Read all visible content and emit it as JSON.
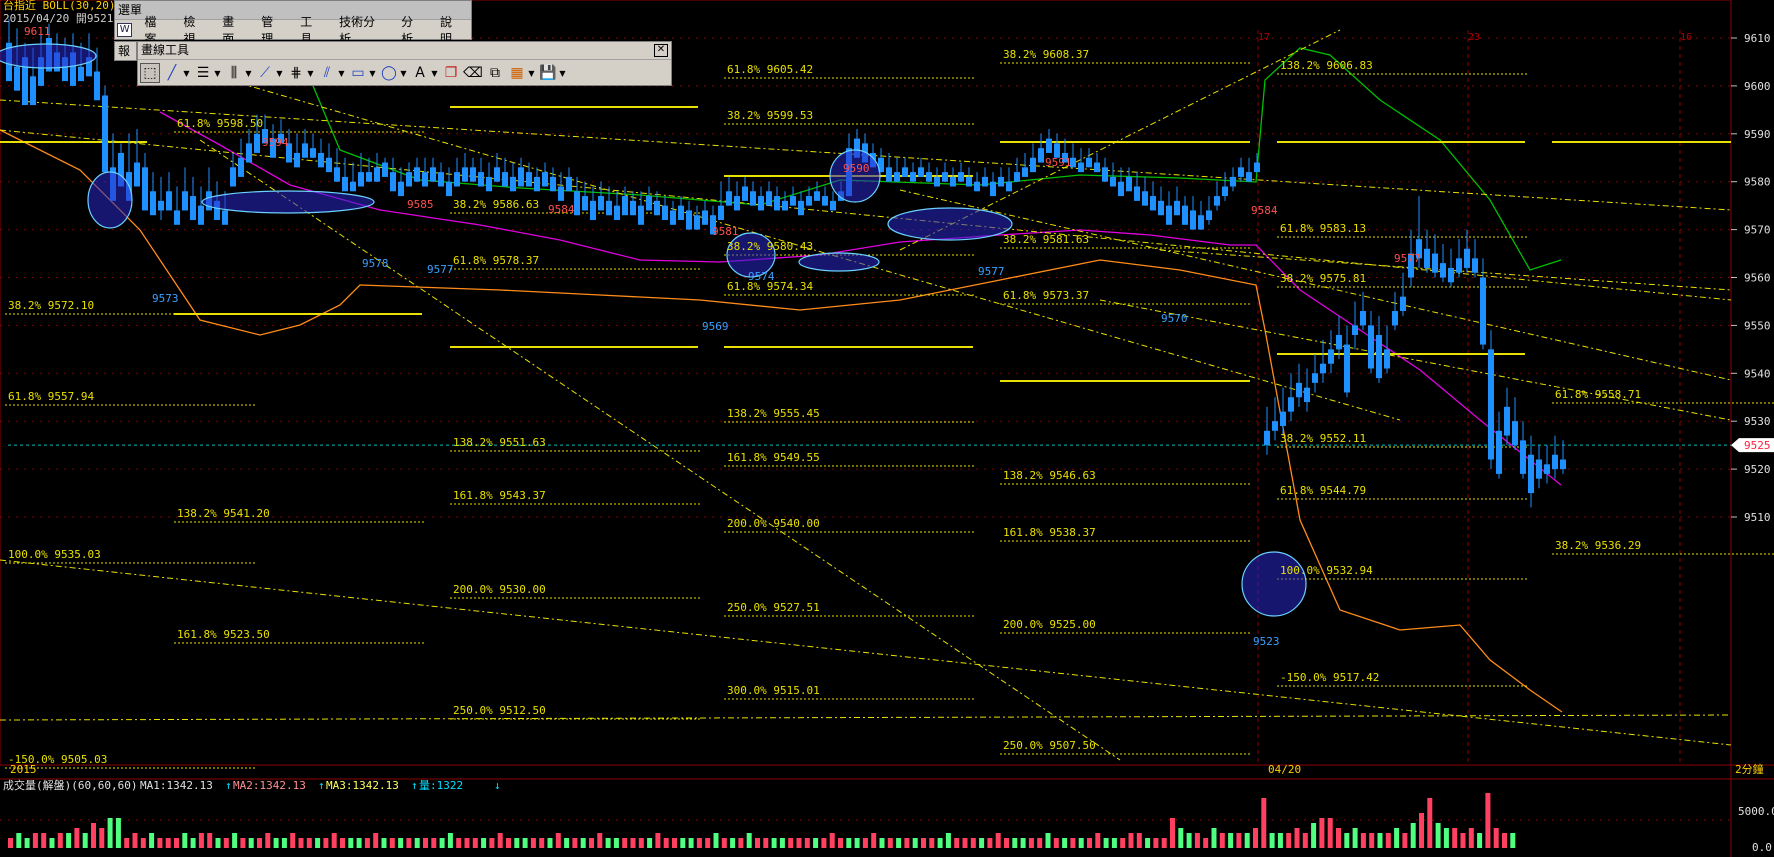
{
  "header": {
    "title": "台指近 BOLL(30,20)",
    "date_open": "2015/04/20 開9521"
  },
  "menu_window": {
    "title": "選單",
    "items": [
      "檔案",
      "檢視",
      "畫面",
      "管理",
      "工具",
      "技術分析",
      "分析",
      "說明"
    ],
    "hidden_tab": "報"
  },
  "drawing_toolbox": {
    "title": "畫線工具",
    "tools": [
      "select-tool-icon",
      "line-tool-icon",
      "hline-tool-icon",
      "vline-tool-icon",
      "fan-tool-icon",
      "fib-tool-icon",
      "channel-tool-icon",
      "rect-tool-icon",
      "ellipse-tool-icon",
      "text-tool-icon",
      "copy-tool-icon",
      "eraser-tool-icon",
      "clone-tool-icon",
      "palette-tool-icon",
      "save-tool-icon"
    ],
    "text_tool_glyph": "A"
  },
  "price_axis": {
    "ticks": [
      "9610",
      "9600",
      "9590",
      "9580",
      "9570",
      "9560",
      "9550",
      "9540",
      "9530",
      "9520",
      "9510"
    ],
    "last_price": "9525"
  },
  "time_axis": {
    "left_label": "2015",
    "mid_label": "04/20",
    "right_label": "2分鐘",
    "session_markers": [
      "17",
      "23",
      "16"
    ]
  },
  "fib_labels": [
    {
      "t": "61.8% 9605.42"
    },
    {
      "t": "38.2% 9599.53"
    },
    {
      "t": "38.2% 9608.37"
    },
    {
      "t": "138.2% 9606.83"
    },
    {
      "t": "61.8% 9598.50"
    },
    {
      "t": "38.2% 9586.63"
    },
    {
      "t": "61.8% 9578.37"
    },
    {
      "t": "38.2% 9580.43"
    },
    {
      "t": "61.8% 9574.34"
    },
    {
      "t": "38.2% 9581.63"
    },
    {
      "t": "61.8% 9573.37"
    },
    {
      "t": "61.8% 9583.13"
    },
    {
      "t": "38.2% 9575.81"
    },
    {
      "t": "38.2% 9572.10"
    },
    {
      "t": "61.8% 9557.94"
    },
    {
      "t": "138.2% 9555.45"
    },
    {
      "t": "61.8% 9558.71"
    },
    {
      "t": "138.2% 9551.63"
    },
    {
      "t": "161.8% 9549.55"
    },
    {
      "t": "38.2% 9552.11"
    },
    {
      "t": "138.2% 9546.63"
    },
    {
      "t": "61.8% 9544.79"
    },
    {
      "t": "161.8% 9543.37"
    },
    {
      "t": "138.2% 9541.20"
    },
    {
      "t": "200.0% 9540.00"
    },
    {
      "t": "161.8% 9538.37"
    },
    {
      "t": "38.2% 9536.29"
    },
    {
      "t": "100.0% 9535.03"
    },
    {
      "t": "100.0% 9532.94"
    },
    {
      "t": "200.0% 9530.00"
    },
    {
      "t": "250.0% 9527.51"
    },
    {
      "t": "200.0% 9525.00"
    },
    {
      "t": "161.8% 9523.50"
    },
    {
      "t": "-150.0% 9517.42"
    },
    {
      "t": "300.0% 9515.01"
    },
    {
      "t": "250.0% 9512.50"
    },
    {
      "t": "250.0% 9507.50"
    },
    {
      "t": "-150.0% 9505.03"
    }
  ],
  "pivot_labels": [
    {
      "t": "9611",
      "c": "#ff5050"
    },
    {
      "t": "9594",
      "c": "#ff5050"
    },
    {
      "t": "9585",
      "c": "#ff5050"
    },
    {
      "t": "9584",
      "c": "#ff5050"
    },
    {
      "t": "9581",
      "c": "#ff5050"
    },
    {
      "t": "9590",
      "c": "#ff5050"
    },
    {
      "t": "9591",
      "c": "#ff5050"
    },
    {
      "t": "9584",
      "c": "#ff5050"
    },
    {
      "t": "9577",
      "c": "#ff5050"
    },
    {
      "t": "9573",
      "c": "#3aa0ff"
    },
    {
      "t": "9578",
      "c": "#3aa0ff"
    },
    {
      "t": "9577",
      "c": "#3aa0ff"
    },
    {
      "t": "9569",
      "c": "#3aa0ff"
    },
    {
      "t": "9574",
      "c": "#3aa0ff"
    },
    {
      "t": "9577",
      "c": "#3aa0ff"
    },
    {
      "t": "9570",
      "c": "#3aa0ff"
    },
    {
      "t": "9523",
      "c": "#3aa0ff"
    }
  ],
  "volume_panel": {
    "label": "成交量(解盤)(60,60,60)",
    "ma1": "MA1:1342.13",
    "ma2": "MA2:1342.13",
    "ma3": "MA3:1342.13",
    "vol": "量:1322",
    "axis_top": "5000.0",
    "axis_bottom": "0.0"
  },
  "colors": {
    "up": "#ff4a5a",
    "down": "#1e90ff",
    "fib": "#e8e000",
    "upper_band": "#00c000",
    "lower_band": "#ff8c1a",
    "mid_band": "#e000e0",
    "grid": "#8b0000",
    "volume_up": "#ff4060",
    "volume_down": "#50ff80"
  }
}
